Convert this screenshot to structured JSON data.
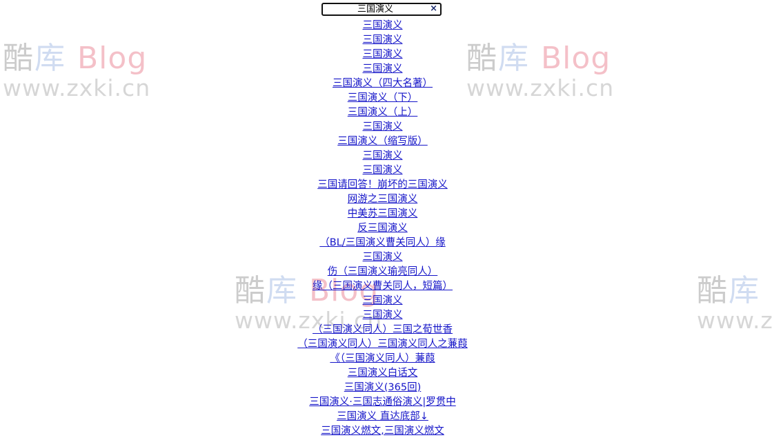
{
  "search": {
    "value": "三国演义",
    "clear_label": "×"
  },
  "watermark": {
    "cn": "酷",
    "lib": "库",
    "blog": "Blog",
    "url": "www.zxki.cn"
  },
  "results": [
    "三国演义",
    "三国演义",
    "三国演义",
    "三国演义",
    "三国演义（四大名著）",
    "三国演义（下）",
    "三国演义（上）",
    "三国演义",
    "三国演义（缩写版）",
    "三国演义",
    "三国演义",
    "三国请回答！崩坏的三国演义",
    "网游之三国演义",
    "中美苏三国演义",
    "反三国演义",
    "（BL/三国演义曹关同人）缘",
    "三国演义",
    "伤（三国演义瑜亮同人）",
    "缘（三国演义曹关同人，短篇）",
    "三国演义",
    "三国演义",
    "（三国演义同人）三国之荀世香",
    "（三国演义同人）三国演义同人之蒹葭",
    "《（三国演义同人）蒹葭",
    "三国演义白话文",
    "三国演义(365回)",
    "三国演义·三国志通俗演义|罗贯中",
    "三国演义 直达底部↓",
    "三国演义燃文,三国演义燃文"
  ]
}
